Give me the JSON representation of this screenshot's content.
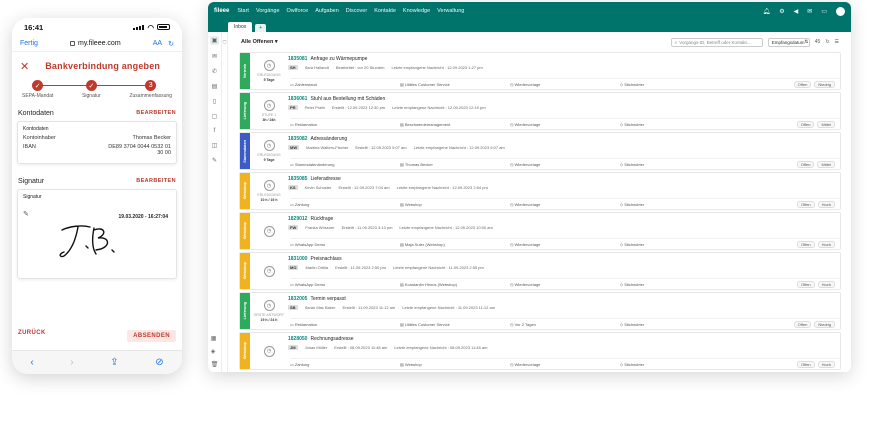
{
  "phone": {
    "time": "16:41",
    "url_done": "Fertig",
    "url": "my.fileee.com",
    "url_aa": "AA",
    "title": "Bankverbindung angeben",
    "steps": [
      {
        "label": "SEPA-Mandat",
        "mark": "✓"
      },
      {
        "label": "Signatur",
        "mark": "✓"
      },
      {
        "label": "Zusammenfassung",
        "mark": "3"
      }
    ],
    "konto": {
      "section": "Kontodaten",
      "edit": "BEARBEITEN",
      "card_title": "Kontodaten",
      "holder_label": "Kontoinhaber",
      "holder_value": "Thomas Becker",
      "iban_label": "IBAN",
      "iban_value_1": "DE89 3704 0044 0532 01",
      "iban_value_2": "30 00"
    },
    "signatur": {
      "section": "Signatur",
      "edit": "BEARBEITEN",
      "card_title": "Signatur",
      "date": "19.03.2020 - 16:27:04"
    },
    "back": "ZURÜCK",
    "send": "ABSENDEN"
  },
  "app": {
    "logo": "fileee",
    "nav": [
      "Start",
      "Vorgänge",
      "Owlforce",
      "Aufgaben",
      "Discover",
      "Kontakte",
      "Knowledge",
      "Verwaltung"
    ],
    "tab": "Inbox",
    "tab_plus": "+",
    "filter": "Alle Offenen",
    "search_placeholder": "Vorgangs-ID, Betreff oder Kontakt...",
    "sort": "Empfangsdatum",
    "count": "45",
    "tickets": [
      {
        "id": "1835081",
        "title": "Anfrage zu Wärmepumpe",
        "band": "Vertrieb",
        "band_color": "#2eaa5c",
        "state": "ERLEDIGUNG",
        "due": "5 Tage",
        "initials": "SH",
        "person": "Sara Hallandt",
        "edited": "Bearbeitet : vor 20 Stunden",
        "last": "Letzte empfangene Nachricht : 12.09.2023 1:27 pm",
        "c1": "Zahlenstand",
        "c2": "Utilites Customer Service",
        "c3": "Wiedervorlage",
        "c4": "Stichwörter",
        "b1": "Offen",
        "b2": "Niedrig"
      },
      {
        "id": "1836061",
        "title": "Stuhl aus Bestellung mit Schäden",
        "band": "Lieferung",
        "band_color": "#2eaa5c",
        "state": "STUFE 1",
        "due": "3h / 24h",
        "initials": "PR",
        "person": "Peter Prath",
        "edited": "Erstellt : 12.09.2023 12:30 pm",
        "last": "Letzte empfangene Nachricht : 12.09.2023 12:19 pm",
        "c1": "Reklamation",
        "c2": "Beschwerdemanagement",
        "c3": "Wiedervorlage",
        "c4": "Stichwörter",
        "b1": "Offen",
        "b2": "Mittel"
      },
      {
        "id": "1835082",
        "title": "Adressänderung",
        "band": "Stammdaten",
        "band_color": "#3b5bc7",
        "state": "ERLEDIGUNG",
        "due": "9 Tage",
        "initials": "MW",
        "person": "Martina Walters-Fischer",
        "edited": "Erstellt : 12.09.2023 9:07 am",
        "last": "Letzte empfangene Nachricht : 12.09.2023 9:07 am",
        "c1": "Stammdatenänderung",
        "c2": "Thomas Becker",
        "c3": "Wiedervorlage",
        "c4": "Stichwörter",
        "b1": "Offen",
        "b2": "Mittel"
      },
      {
        "id": "1835085",
        "title": "Lieferadresse",
        "band": "Webshop",
        "band_color": "#f0b31f",
        "state": "ERLEDIGUNG",
        "due": "10 h / 19 h",
        "initials": "KS",
        "person": "Kevin Schuster",
        "edited": "Erstellt : 12.09.2023 7:04 am",
        "last": "Letzte empfangene Nachricht : 12.09.2023 2:54 pm",
        "c1": "Zahlung",
        "c2": "Webshop",
        "c3": "Wiedervorlage",
        "c4": "Stichwörter",
        "b1": "Offen",
        "b2": "Hoch"
      },
      {
        "id": "1829012",
        "title": "Rückfrage",
        "band": "Webshop",
        "band_color": "#f0b31f",
        "state": "",
        "due": "",
        "initials": "FW",
        "person": "Franka Wössner",
        "edited": "Erstellt : 11.09.2023 3:13 pm",
        "last": "Letzte empfangene Nachricht : 12.09.2023 10:00 am",
        "c1": "WhatsApp Demo",
        "c2": "Maja Suter (Webshop)",
        "c3": "Wiedervorlage",
        "c4": "Stichwörter",
        "b1": "Offen",
        "b2": "Hoch"
      },
      {
        "id": "1831000",
        "title": "Preisnachlass",
        "band": "Webshop",
        "band_color": "#f0b31f",
        "state": "",
        "due": "",
        "initials": "MO",
        "person": "Martin Ortilla",
        "edited": "Erstellt : 11.09.2023 2:50 pm",
        "last": "Letzte empfangene Nachricht : 11.09.2023 2:55 pm",
        "c1": "WhatsApp Demo",
        "c2": "Konstantin Hinrus (Webshop)",
        "c3": "Wiedervorlage",
        "c4": "Stichwörter",
        "b1": "Offen",
        "b2": "Hoch"
      },
      {
        "id": "1832005",
        "title": "Termin verpasst",
        "band": "Lieferung",
        "band_color": "#2eaa5c",
        "state": "ERSTE ANTWORT",
        "due": "19 h / 24 h",
        "initials": "SB",
        "person": "Sarah Mac Baker",
        "edited": "Erstellt : 11.09.2023 11:12 am",
        "last": "Letzte empfangene Nachricht : 11.09.2023 11:12 am",
        "c1": "Reklamation",
        "c2": "Utilites Customer Service",
        "c3": "Vor 2 Tagen",
        "c4": "Stichwörter",
        "b1": "Offen",
        "b2": "Niedrig"
      },
      {
        "id": "1828050",
        "title": "Rechnungsadresse",
        "band": "Webshop",
        "band_color": "#f0b31f",
        "state": "",
        "due": "",
        "initials": "JM",
        "person": "Jonas Müller",
        "edited": "Erstellt : 08.09.2023 11:48 am",
        "last": "Letzte empfangene Nachricht : 08.09.2023 11:48 am",
        "c1": "Zahlung",
        "c2": "Webshop",
        "c3": "Wiedervorlage",
        "c4": "Stichwörter",
        "b1": "Offen",
        "b2": "Hoch"
      }
    ]
  }
}
